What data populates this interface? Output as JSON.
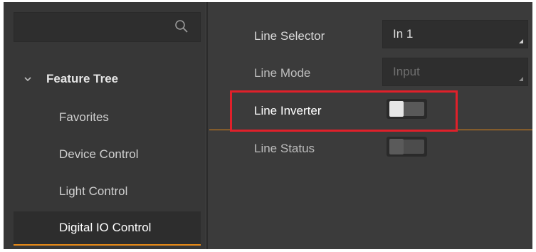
{
  "search": {
    "placeholder": "",
    "icon": "search-icon"
  },
  "tree": {
    "title": "Feature Tree",
    "expanded": true,
    "items": [
      {
        "label": "Favorites",
        "active": false
      },
      {
        "label": "Device Control",
        "active": false
      },
      {
        "label": "Light Control",
        "active": false
      },
      {
        "label": "Digital IO Control",
        "active": true
      }
    ]
  },
  "properties": {
    "line_selector": {
      "label": "Line Selector",
      "value": "In 1"
    },
    "line_mode": {
      "label": "Line Mode",
      "value": "Input",
      "enabled": false
    },
    "line_inverter": {
      "label": "Line Inverter",
      "checked": false
    },
    "line_status": {
      "label": "Line Status",
      "checked": false,
      "enabled": false
    }
  },
  "colors": {
    "accent": "#e88a17",
    "highlight": "#e0202a",
    "panel": "#3b3b3b"
  }
}
